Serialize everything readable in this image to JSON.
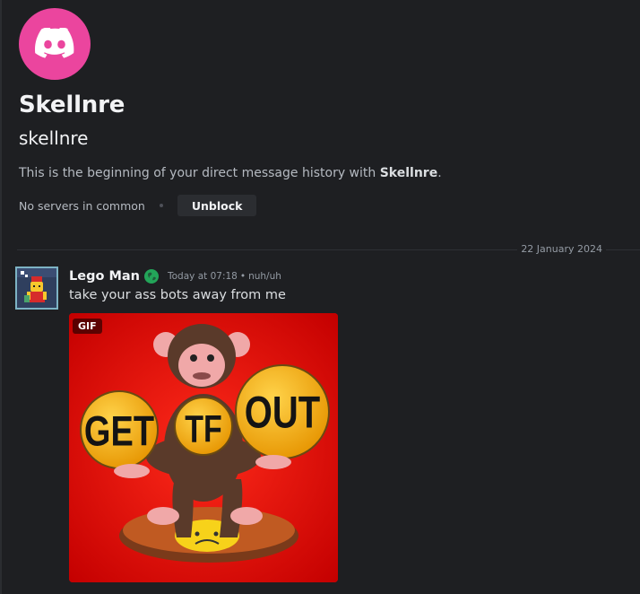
{
  "profile": {
    "display_name": "Skellnre",
    "username": "skellnre",
    "avatar_icon": "discord-logo-icon",
    "avatar_color": "#eb459e"
  },
  "intro": {
    "prefix": "This is the beginning of your direct message history with ",
    "name": "Skellnre",
    "suffix": "."
  },
  "actions": {
    "servers_text": "No servers in common",
    "unblock_label": "Unblock"
  },
  "divider": {
    "date": "22 January 2024"
  },
  "message": {
    "author": "Lego Man",
    "badge_icon": "globe-icon",
    "timestamp": "Today at 07:18",
    "separator": "•",
    "status_note": "nuh/uh",
    "text": "take your ass bots away from me",
    "gif_label": "GIF",
    "gif_text": {
      "left": "GET",
      "center": "TF",
      "right": "OUT"
    }
  },
  "colors": {
    "background": "#1e1f22",
    "brand_pink": "#eb459e",
    "gif_background": "#e10000",
    "badge_green": "#23a559"
  }
}
